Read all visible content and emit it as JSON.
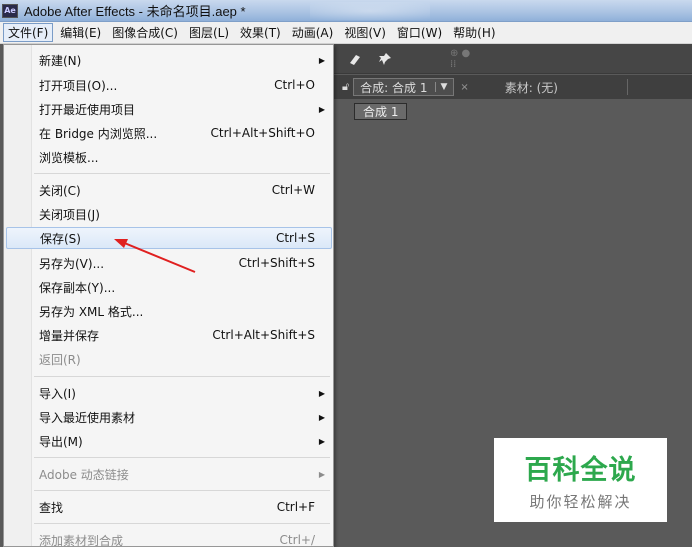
{
  "window": {
    "title": "Adobe After Effects - 未命名项目.aep *",
    "app_icon": "Ae"
  },
  "menubar": {
    "items": [
      "文件(F)",
      "编辑(E)",
      "图像合成(C)",
      "图层(L)",
      "效果(T)",
      "动画(A)",
      "视图(V)",
      "窗口(W)",
      "帮助(H)"
    ]
  },
  "file_menu": {
    "items": [
      {
        "label": "新建(N)",
        "shortcut": "",
        "submenu": true,
        "disabled": false
      },
      {
        "label": "打开项目(O)...",
        "shortcut": "Ctrl+O",
        "submenu": false,
        "disabled": false
      },
      {
        "label": "打开最近使用项目",
        "shortcut": "",
        "submenu": true,
        "disabled": false
      },
      {
        "label": "在 Bridge 内浏览照...",
        "shortcut": "Ctrl+Alt+Shift+O",
        "submenu": false,
        "disabled": false
      },
      {
        "label": "浏览模板...",
        "shortcut": "",
        "submenu": false,
        "disabled": false
      },
      {
        "label": "关闭(C)",
        "shortcut": "Ctrl+W",
        "submenu": false,
        "disabled": false
      },
      {
        "label": "关闭项目(J)",
        "shortcut": "",
        "submenu": false,
        "disabled": false
      },
      {
        "label": "保存(S)",
        "shortcut": "Ctrl+S",
        "submenu": false,
        "disabled": false,
        "highlighted": true
      },
      {
        "label": "另存为(V)...",
        "shortcut": "Ctrl+Shift+S",
        "submenu": false,
        "disabled": false
      },
      {
        "label": "保存副本(Y)...",
        "shortcut": "",
        "submenu": false,
        "disabled": false
      },
      {
        "label": "另存为 XML 格式...",
        "shortcut": "",
        "submenu": false,
        "disabled": false
      },
      {
        "label": "增量并保存",
        "shortcut": "Ctrl+Alt+Shift+S",
        "submenu": false,
        "disabled": false
      },
      {
        "label": "返回(R)",
        "shortcut": "",
        "submenu": false,
        "disabled": true
      },
      {
        "label": "导入(I)",
        "shortcut": "",
        "submenu": true,
        "disabled": false
      },
      {
        "label": "导入最近使用素材",
        "shortcut": "",
        "submenu": true,
        "disabled": false
      },
      {
        "label": "导出(M)",
        "shortcut": "",
        "submenu": true,
        "disabled": false
      },
      {
        "label": "Adobe 动态链接",
        "shortcut": "",
        "submenu": true,
        "disabled": true
      },
      {
        "label": "查找",
        "shortcut": "Ctrl+F",
        "submenu": false,
        "disabled": false
      },
      {
        "label": "添加素材到合成",
        "shortcut": "Ctrl+/",
        "submenu": false,
        "disabled": true
      }
    ]
  },
  "panel": {
    "comp_tab": "合成: 合成 1",
    "footage_tab": "素材: (无)",
    "sub_tab": "合成 1"
  },
  "watermark": {
    "main": "百科全说",
    "sub": "助你轻松解决"
  },
  "colors": {
    "highlight": "#dbe8f8",
    "arrow": "#e02020",
    "watermark_green": "#2da84d"
  }
}
